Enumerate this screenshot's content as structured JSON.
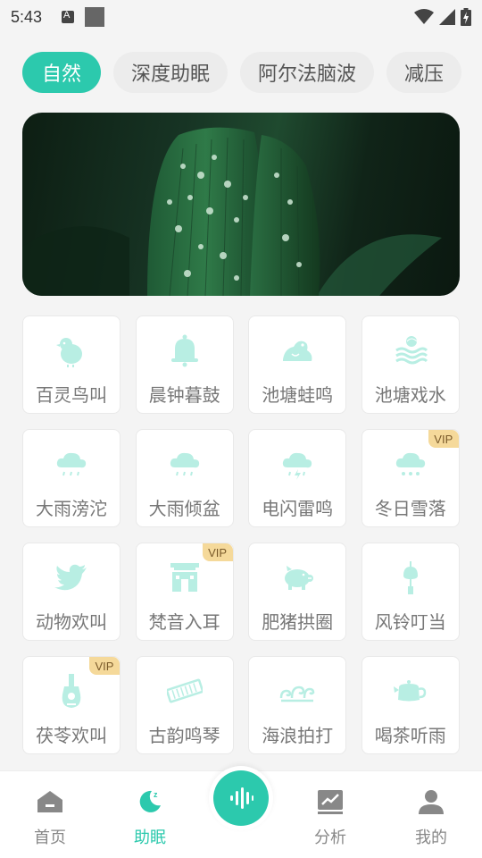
{
  "status_bar": {
    "time": "5:43"
  },
  "tabs": [
    {
      "label": "自然",
      "active": true
    },
    {
      "label": "深度助眠",
      "active": false
    },
    {
      "label": "阿尔法脑波",
      "active": false
    },
    {
      "label": "减压",
      "active": false
    }
  ],
  "tiles": [
    {
      "label": "百灵鸟叫",
      "icon": "bird-icon",
      "vip": false
    },
    {
      "label": "晨钟暮鼓",
      "icon": "bell-icon",
      "vip": false
    },
    {
      "label": "池塘蛙鸣",
      "icon": "frog-icon",
      "vip": false
    },
    {
      "label": "池塘戏水",
      "icon": "water-icon",
      "vip": false
    },
    {
      "label": "大雨滂沱",
      "icon": "rain-cloud-icon",
      "vip": false
    },
    {
      "label": "大雨倾盆",
      "icon": "rain-cloud-icon",
      "vip": false
    },
    {
      "label": "电闪雷鸣",
      "icon": "thunder-cloud-icon",
      "vip": false
    },
    {
      "label": "冬日雪落",
      "icon": "snow-cloud-icon",
      "vip": true
    },
    {
      "label": "动物欢叫",
      "icon": "twitter-bird-icon",
      "vip": false
    },
    {
      "label": "梵音入耳",
      "icon": "temple-icon",
      "vip": true
    },
    {
      "label": "肥猪拱圈",
      "icon": "pig-icon",
      "vip": false
    },
    {
      "label": "风铃叮当",
      "icon": "wind-chime-icon",
      "vip": false
    },
    {
      "label": "茯苓欢叫",
      "icon": "guitar-icon",
      "vip": true
    },
    {
      "label": "古韵鸣琴",
      "icon": "zither-icon",
      "vip": false
    },
    {
      "label": "海浪拍打",
      "icon": "wave-icon",
      "vip": false
    },
    {
      "label": "喝茶听雨",
      "icon": "teapot-icon",
      "vip": false
    }
  ],
  "vip_label": "VIP",
  "bottom_nav": {
    "home": "首页",
    "sleep": "助眠",
    "analysis": "分析",
    "mine": "我的"
  },
  "colors": {
    "accent": "#2cc9ad",
    "icon": "#b8eee3"
  }
}
